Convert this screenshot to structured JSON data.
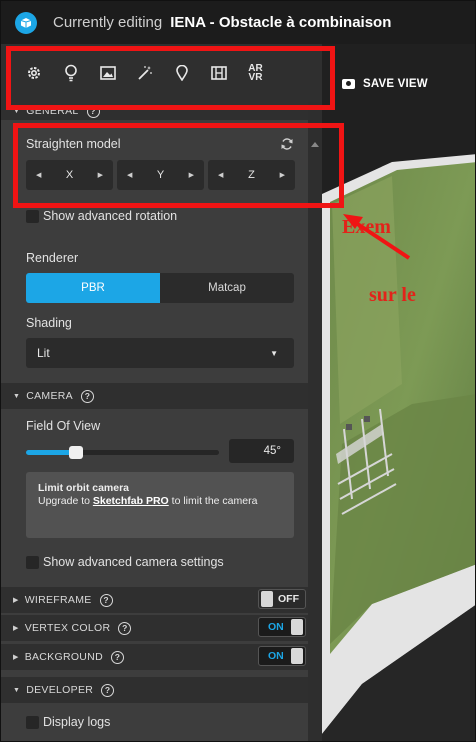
{
  "topbar": {
    "edit_label": "Currently editing",
    "title": "IENA - Obstacle à combinaison"
  },
  "toolbar": {
    "tools": [
      "gear-icon",
      "bulb-icon",
      "image-icon",
      "magic-wand-icon",
      "marker-icon",
      "film-icon"
    ],
    "ar_vr_line1": "AR",
    "ar_vr_line2": "VR"
  },
  "viewport": {
    "save_view_label": "SAVE VIEW",
    "annotation_line1": "Exem",
    "annotation_line2": "sur le"
  },
  "general": {
    "header": "GENERAL",
    "straighten_label": "Straighten model",
    "axes": [
      "X",
      "Y",
      "Z"
    ],
    "advanced_rotation_label": "Show advanced rotation",
    "renderer_label": "Renderer",
    "renderer_options": [
      "PBR",
      "Matcap"
    ],
    "renderer_selected": "PBR",
    "shading_label": "Shading",
    "shading_value": "Lit"
  },
  "camera": {
    "header": "CAMERA",
    "fov_label": "Field Of View",
    "fov_value": "45°",
    "fov_fraction": 0.26,
    "orbit_title": "Limit orbit camera",
    "orbit_text_before": "Upgrade to",
    "orbit_link": "Sketchfab PRO",
    "orbit_text_after": "to limit the camera",
    "advanced_label": "Show advanced camera settings"
  },
  "wireframe": {
    "header": "WIREFRAME",
    "state": "OFF"
  },
  "vertex_color": {
    "header": "VERTEX COLOR",
    "state": "ON"
  },
  "background": {
    "header": "BACKGROUND",
    "state": "ON"
  },
  "developer": {
    "header": "DEVELOPER",
    "display_logs_label": "Display logs"
  },
  "colors": {
    "accent": "#1ca6e6",
    "annotation_red": "#f01414"
  }
}
